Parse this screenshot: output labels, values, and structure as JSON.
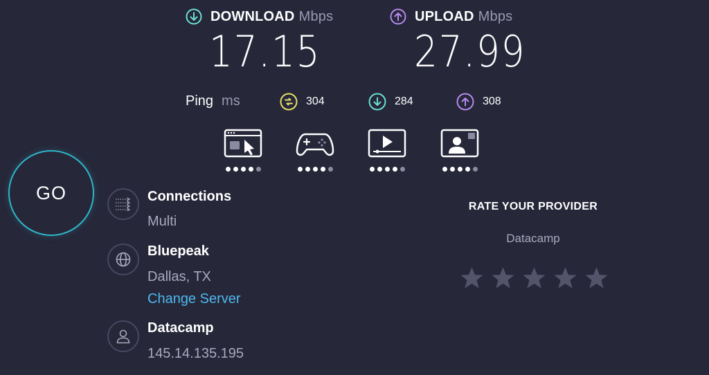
{
  "download": {
    "label": "DOWNLOAD",
    "unit": "Mbps",
    "value": "17.15",
    "icon": "arrow-down-circle-icon",
    "color": "#6ae0d0"
  },
  "upload": {
    "label": "UPLOAD",
    "unit": "Mbps",
    "value": "27.99",
    "icon": "arrow-up-circle-icon",
    "color": "#b68af0"
  },
  "ping": {
    "label": "Ping",
    "unit": "ms",
    "idle": "304",
    "download": "284",
    "upload": "308",
    "idle_color": "#e8df6a"
  },
  "ratings": [
    {
      "name": "web-browsing-icon",
      "filled": 4,
      "total": 5
    },
    {
      "name": "gaming-icon",
      "filled": 4,
      "total": 5
    },
    {
      "name": "video-streaming-icon",
      "filled": 4,
      "total": 5
    },
    {
      "name": "video-chat-icon",
      "filled": 4,
      "total": 5
    }
  ],
  "go": {
    "label": "GO"
  },
  "connections": {
    "title": "Connections",
    "value": "Multi"
  },
  "server": {
    "title": "Bluepeak",
    "location": "Dallas, TX",
    "change_label": "Change Server"
  },
  "provider": {
    "title": "Datacamp",
    "ip": "145.14.135.195"
  },
  "rate_provider": {
    "title": "RATE YOUR PROVIDER",
    "name": "Datacamp",
    "stars": 5
  },
  "colors": {
    "background": "#262739",
    "accent": "#2fb6c8",
    "link": "#4fb8ee",
    "muted": "#a9aabd"
  }
}
